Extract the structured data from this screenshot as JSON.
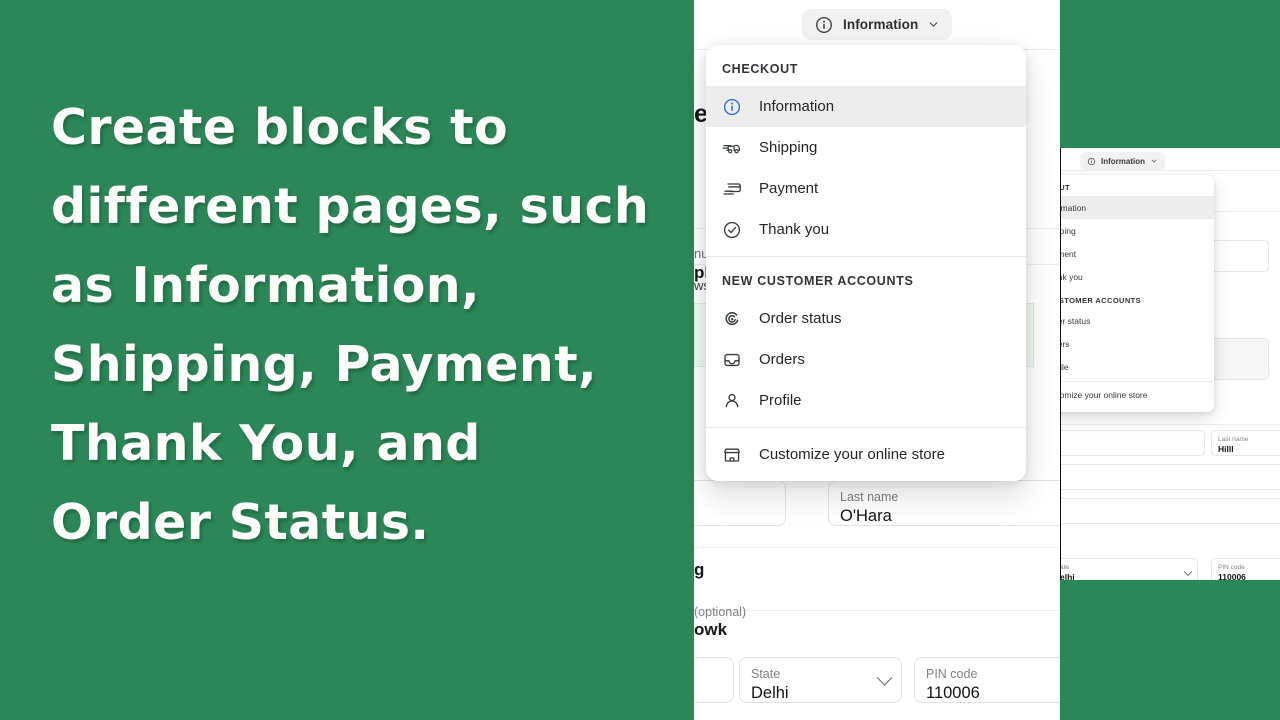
{
  "promo": {
    "background_color": "#2b8757",
    "text_color": "#fdfdfb",
    "headline": "Create blocks to different pages, such as Information, Shipping, Payment, Thank You, and Order Status."
  },
  "toolbar": {
    "page_selector_label": "Information",
    "page_selector_icon": "info-circle-icon",
    "chevron_icon": "chevron-down-icon"
  },
  "dropdown": {
    "sections": [
      {
        "heading": "CHECKOUT",
        "items": [
          {
            "label": "Information",
            "icon": "info-circle-icon",
            "selected": true
          },
          {
            "label": "Shipping",
            "icon": "delivery-truck-icon",
            "selected": false
          },
          {
            "label": "Payment",
            "icon": "credit-card-swipe-icon",
            "selected": false
          },
          {
            "label": "Thank you",
            "icon": "check-circle-icon",
            "selected": false
          }
        ]
      },
      {
        "heading": "NEW CUSTOMER ACCOUNTS",
        "items": [
          {
            "label": "Order status",
            "icon": "order-status-icon",
            "selected": false
          },
          {
            "label": "Orders",
            "icon": "inbox-icon",
            "selected": false
          },
          {
            "label": "Profile",
            "icon": "person-icon",
            "selected": false
          }
        ]
      }
    ],
    "footer": {
      "label": "Customize your online store",
      "icon": "storefront-icon"
    },
    "selected_accent_color": "#2c6ecb"
  },
  "checkout_form": {
    "fragments": {
      "f1": "e",
      "f2": "nu",
      "f3": "pl",
      "f4": "ws",
      "f5": "g",
      "f6": "(optional)",
      "f7": "owk"
    },
    "fields": [
      {
        "label": "Last name",
        "value": "O'Hara"
      },
      {
        "label": "State",
        "value": "Delhi",
        "control": "select"
      },
      {
        "label": "PIN code",
        "value": "110006"
      }
    ]
  },
  "inset": {
    "page_selector_label": "Information",
    "menu": {
      "sections": [
        {
          "heading": "OUT",
          "items": [
            {
              "label": "ormation",
              "selected": true
            },
            {
              "label": "ipping",
              "selected": false
            },
            {
              "label": "yment",
              "selected": false
            },
            {
              "label": "ank you",
              "selected": false
            }
          ]
        },
        {
          "heading": "USTOMER ACCOUNTS",
          "items": [
            {
              "label": "der status",
              "selected": false
            },
            {
              "label": "ders",
              "selected": false
            },
            {
              "label": "ofile",
              "selected": false
            }
          ]
        }
      ],
      "footer": {
        "label": "stomize your online store"
      }
    },
    "fields": [
      {
        "label": "Last name",
        "value": "Hilll"
      },
      {
        "label": "ate",
        "value": "elhi",
        "control": "select"
      },
      {
        "label": "PIN code",
        "value": "110006"
      }
    ],
    "search_icon": "magnifier-icon"
  }
}
